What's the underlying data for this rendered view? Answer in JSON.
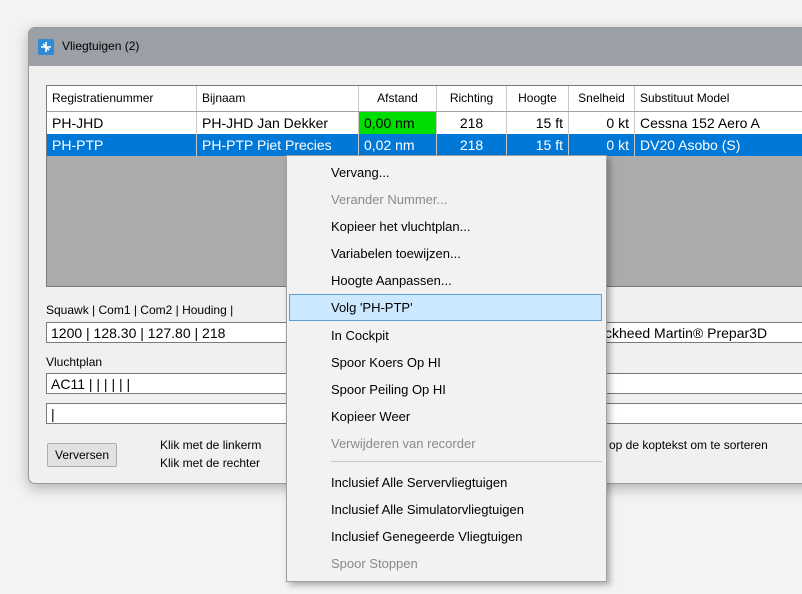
{
  "window": {
    "title": "Vliegtuigen (2)"
  },
  "table": {
    "columns": [
      "Registratienummer",
      "Bijnaam",
      "Afstand",
      "Richting",
      "Hoogte",
      "Snelheid",
      "Substituut Model"
    ],
    "rows": [
      [
        "PH-JHD",
        "PH-JHD  Jan Dekker",
        "0,00 nm",
        "218",
        "15 ft",
        "0 kt",
        "Cessna 152 Aero A"
      ],
      [
        "PH-PTP",
        "PH-PTP  Piet Precies",
        "0,02 nm",
        "218",
        "15 ft",
        "0 kt",
        "DV20 Asobo (S)"
      ]
    ]
  },
  "status": {
    "label": "Squawk | Com1 | Com2 | Houding |",
    "value": "1200 | 128.30 | 127.80 | 218",
    "value_right": "ckheed Martin® Prepar3D"
  },
  "flightplan": {
    "label": "Vluchtplan",
    "value": "AC11 |  |  |  |  |  |",
    "input_value": "|"
  },
  "footer": {
    "refresh_button": "Verversen",
    "hint_left_1": "Klik met de linkerm",
    "hint_left_2": "Klik met de rechter",
    "hint_right": "op de koptekst om te sorteren"
  },
  "menu": {
    "items": [
      {
        "label": "Vervang...",
        "enabled": true
      },
      {
        "label": "Verander Nummer...",
        "enabled": false
      },
      {
        "label": "Kopieer het vluchtplan...",
        "enabled": true
      },
      {
        "label": "Variabelen toewijzen...",
        "enabled": true
      },
      {
        "label": "Hoogte Aanpassen...",
        "enabled": true
      },
      {
        "label": "Volg 'PH-PTP'",
        "enabled": true,
        "highlighted": true
      },
      {
        "label": "In Cockpit",
        "enabled": true
      },
      {
        "label": "Spoor Koers Op HI",
        "enabled": true
      },
      {
        "label": "Spoor Peiling Op HI",
        "enabled": true
      },
      {
        "label": "Kopieer Weer",
        "enabled": true
      },
      {
        "label": "Verwijderen van recorder",
        "enabled": false
      },
      {
        "label": "Inclusief Alle Servervliegtuigen",
        "enabled": true
      },
      {
        "label": "Inclusief Alle Simulatorvliegtuigen",
        "enabled": true
      },
      {
        "label": "Inclusief Genegeerde Vliegtuigen",
        "enabled": true
      },
      {
        "label": "Spoor Stoppen",
        "enabled": false
      }
    ]
  },
  "colors": {
    "selection": "#0078d7",
    "distance_highlight": "#00dd00",
    "menu_highlight": "#cce8ff"
  },
  "icons": {
    "app": "aircraft-list-icon"
  }
}
